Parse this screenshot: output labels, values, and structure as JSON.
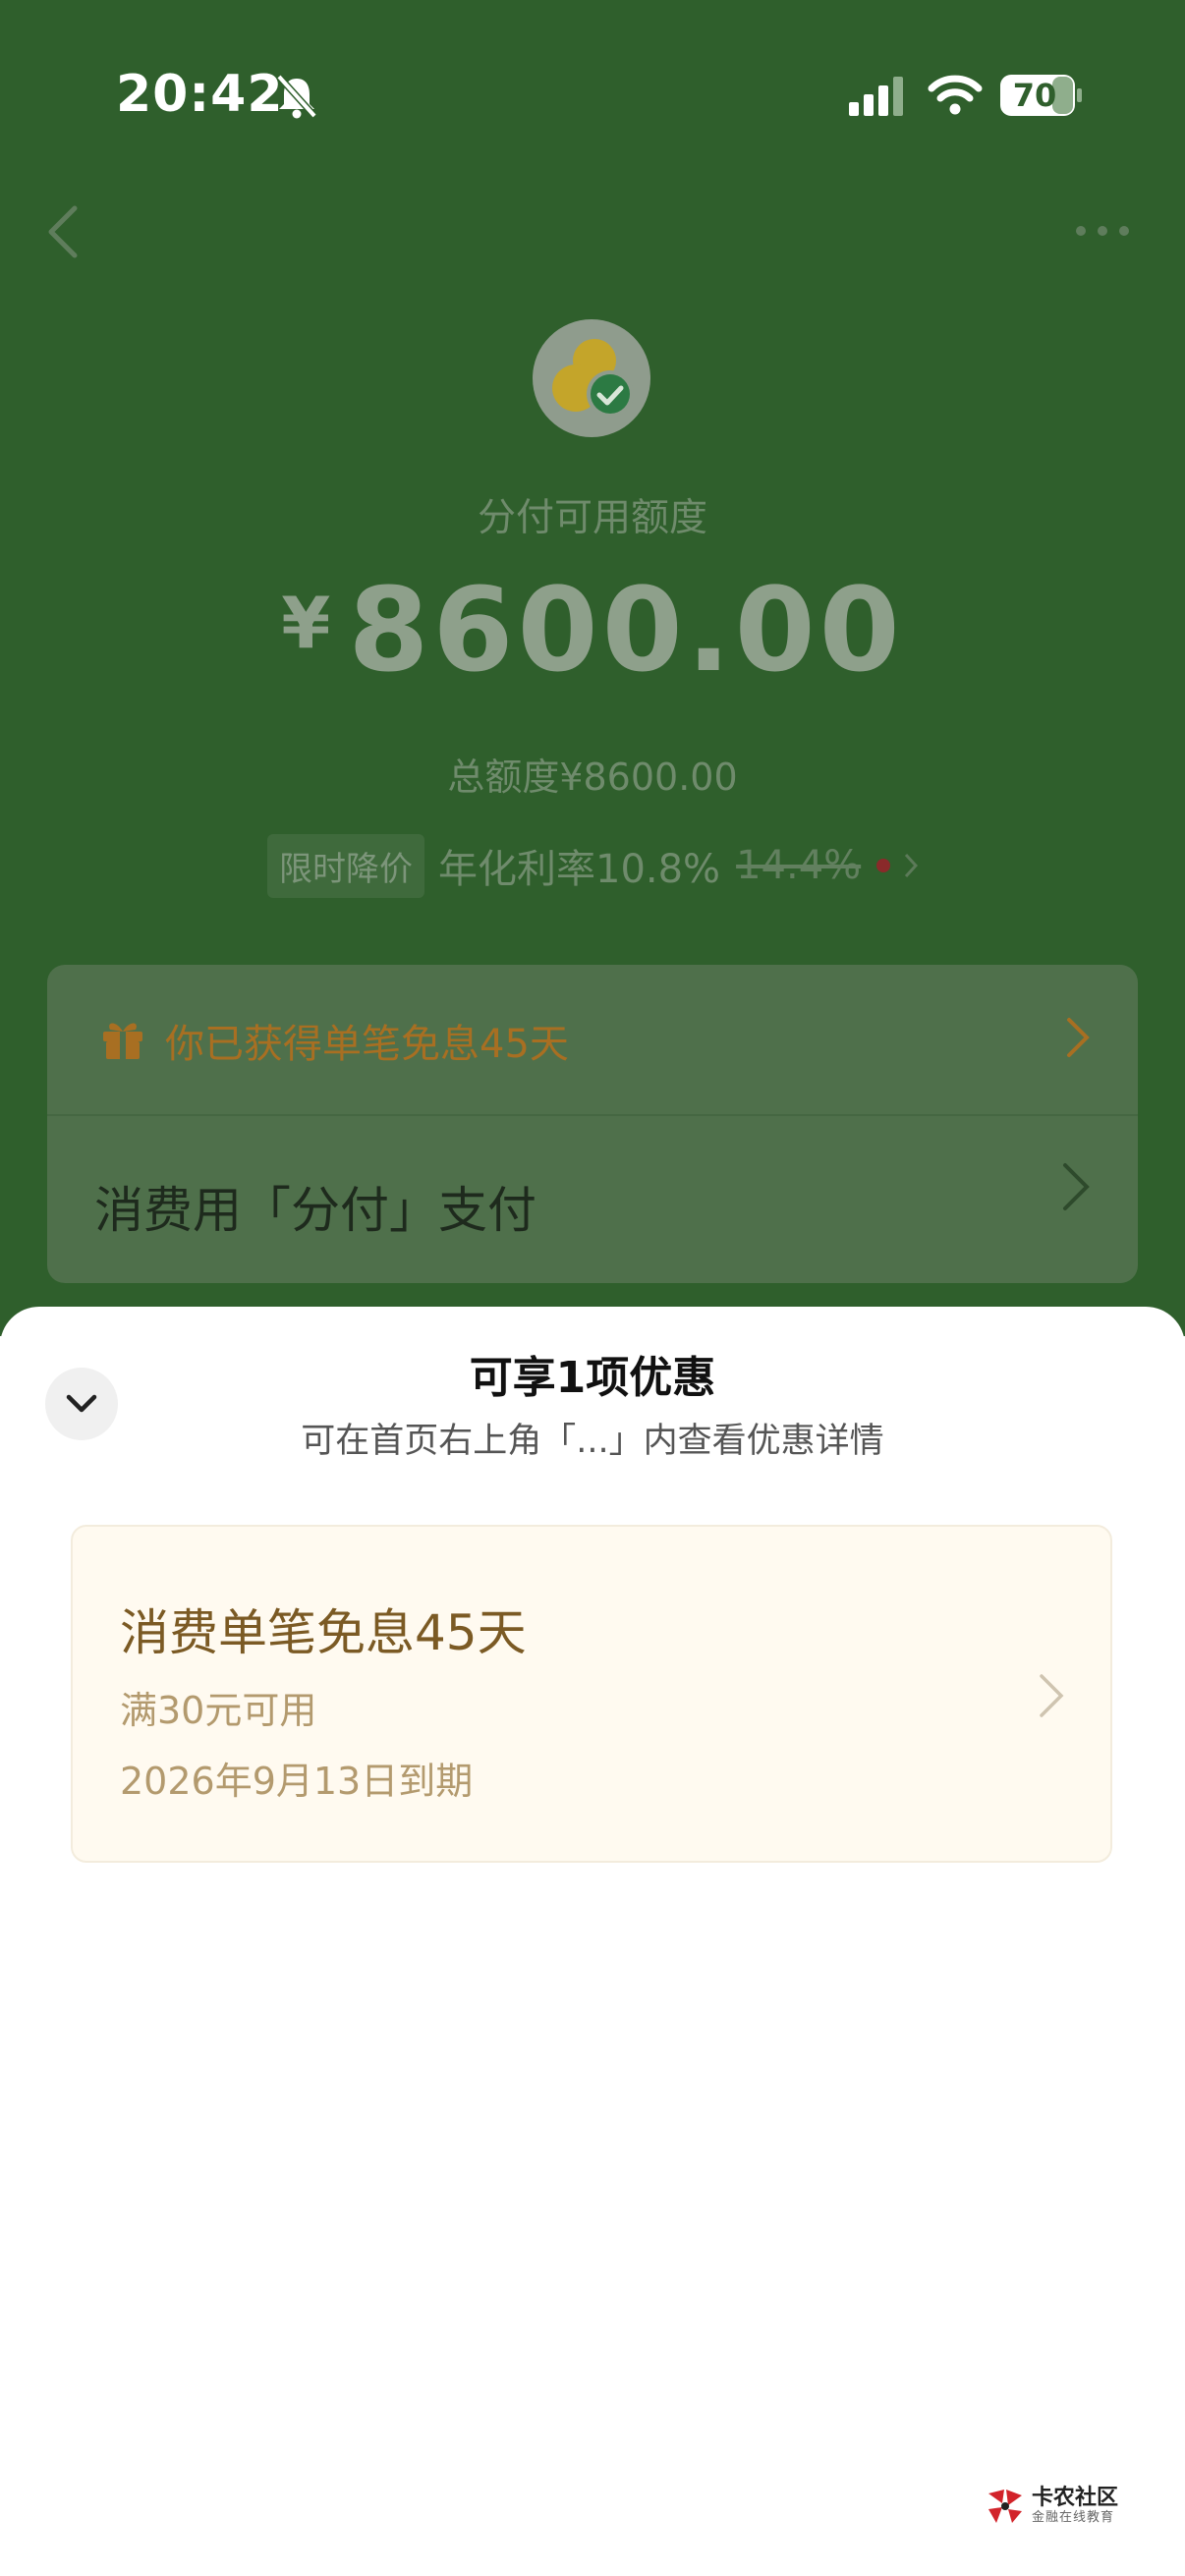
{
  "status_bar": {
    "time": "20:42",
    "battery": "70"
  },
  "header": {
    "available_label": "分付可用额度",
    "currency_symbol": "¥",
    "available_amount": "8600.00",
    "total_limit": "总额度¥8600.00",
    "rate_tag": "限时降价",
    "rate_current": "年化利率10.8%",
    "rate_old": "14.4%"
  },
  "card": {
    "promo_text": "你已获得单笔免息45天",
    "pay_text": "消费用「分付」支付"
  },
  "sheet": {
    "title": "可享1项优惠",
    "subtitle": "可在首页右上角「...」内查看优惠详情",
    "coupon": {
      "title": "消费单笔免息45天",
      "condition": "满30元可用",
      "expiry": "2026年9月13日到期"
    }
  },
  "watermark": {
    "name": "卡农社区",
    "tagline": "金融在线教育"
  },
  "colors": {
    "header_bg": "#2f5f2c",
    "accent_gold": "#7b5a24",
    "promo_orange": "#a86f22"
  }
}
